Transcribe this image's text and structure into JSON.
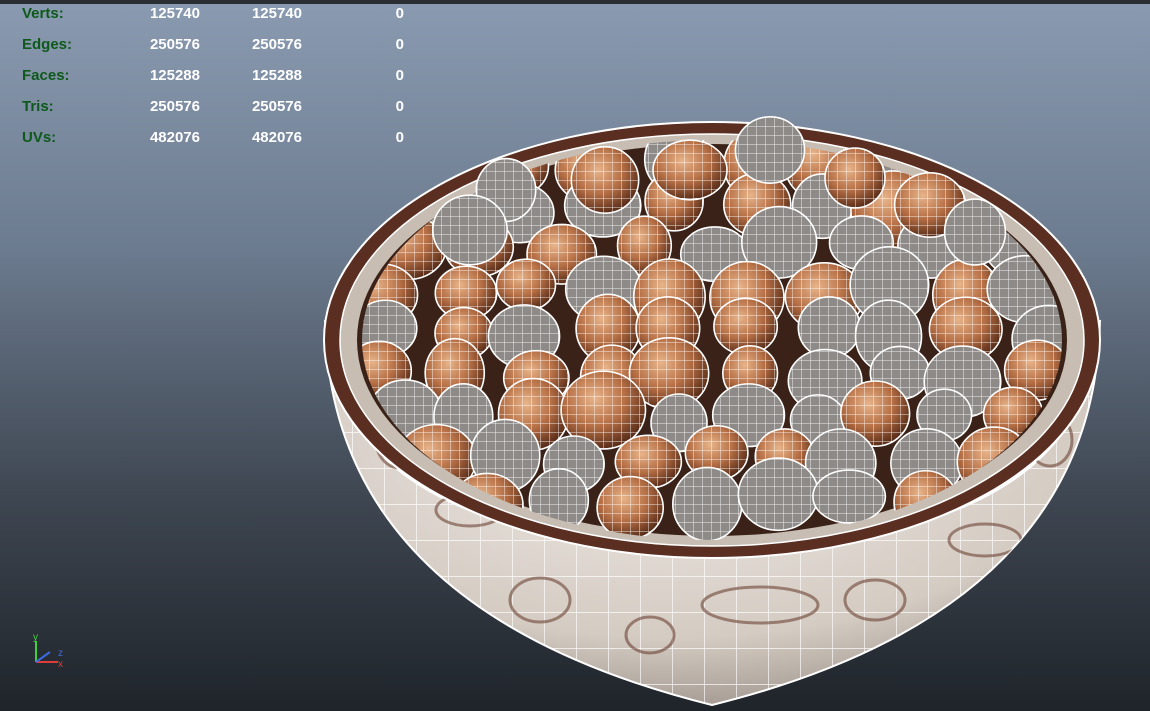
{
  "stats": [
    {
      "label": "Verts:",
      "a": "125740",
      "b": "125740",
      "c": "0"
    },
    {
      "label": "Edges:",
      "a": "250576",
      "b": "250576",
      "c": "0"
    },
    {
      "label": "Faces:",
      "a": "125288",
      "b": "125288",
      "c": "0"
    },
    {
      "label": "Tris:",
      "a": "250576",
      "b": "250576",
      "c": "0"
    },
    {
      "label": "UVs:",
      "a": "482076",
      "b": "482076",
      "c": "0"
    }
  ],
  "axis": {
    "y": "y",
    "x": "x",
    "z": "z"
  },
  "colors": {
    "hud_label": "#0d5a1a",
    "hud_value": "#ffffff",
    "wire": "#ffffff",
    "bowl_shell": "#e7e1da",
    "bowl_rim": "#5a2f22",
    "nut": "#b9764d"
  }
}
